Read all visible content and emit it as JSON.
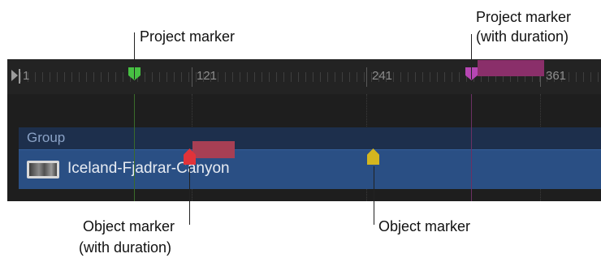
{
  "callouts": {
    "project_marker": "Project marker",
    "project_marker_duration_line1": "Project marker",
    "project_marker_duration_line2": "(with duration)",
    "object_marker_duration_line1": "Object marker",
    "object_marker_duration_line2": "(with duration)",
    "object_marker": "Object marker"
  },
  "ruler": {
    "labels": [
      "1",
      "121",
      "241",
      "361"
    ]
  },
  "timeline": {
    "group_label": "Group",
    "layer_name": "Iceland-Fjadrar-Canyon"
  },
  "markers": {
    "project": {
      "color": "#47c043"
    },
    "project_duration": {
      "color": "#b646b3",
      "duration_color": "#8a2f6a"
    },
    "object_duration": {
      "color": "#e1333a",
      "duration_color": "#a73f54"
    },
    "object": {
      "color": "#d4b61f"
    }
  }
}
